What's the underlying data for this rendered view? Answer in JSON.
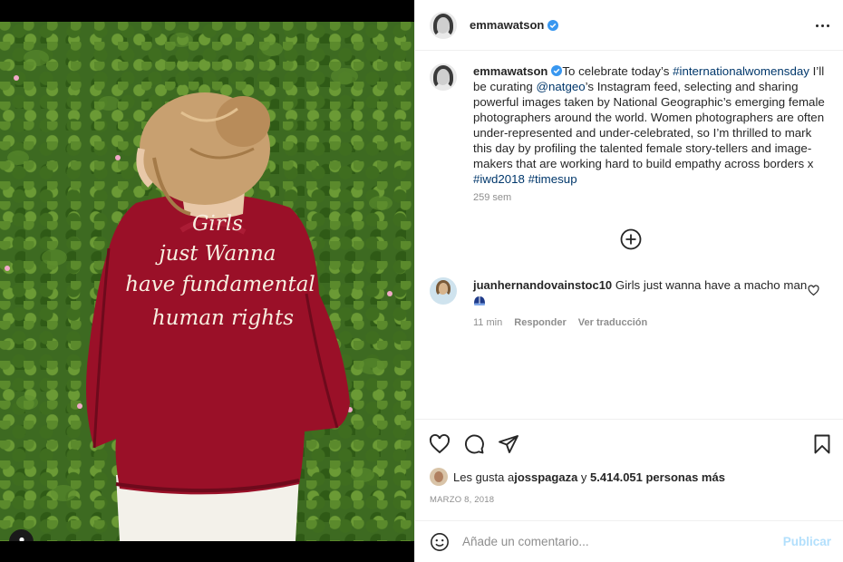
{
  "header": {
    "username": "emmawatson",
    "verified": true,
    "avatar_icon": "profile-avatar",
    "more_icon": "more-horizontal-icon"
  },
  "caption": {
    "username": "emmawatson",
    "text_1": "To celebrate today’s ",
    "hashtag_1": "#internationalwomensday",
    "text_2": " I’ll be curating ",
    "mention": "@natgeo",
    "text_3": "’s Instagram feed, selecting and sharing powerful images taken by National Geographic’s emerging female photographers around the world. Women photographers are often under-represented and under-celebrated, so I’m thrilled to mark this day by profiling the talented female story-tellers and image-makers that are working hard to build empathy across borders x ",
    "hashtag_2": "#iwd2018",
    "hashtag_3": "#timesup",
    "age": "259 sem"
  },
  "load_more_icon": "plus-circle-icon",
  "comment": {
    "username": "juanhernandovainstoc10",
    "text": "Girls just wanna have a macho man",
    "emoji": "helmet-emoji",
    "age": "11 min",
    "reply_label": "Responder",
    "translate_label": "Ver traducción"
  },
  "photo": {
    "jacket_lines": [
      "Girls",
      "just Wanna",
      "have fundamental",
      "human rights"
    ],
    "colors": {
      "jacket": "#9a1028",
      "hedge": "#3d6a21",
      "hair": "#c8a070"
    }
  },
  "likes": {
    "prefix": "Les gusta a ",
    "liker": "josspagaza",
    "middle": " y ",
    "count": "5.414.051 personas más"
  },
  "date": "MARZO 8, 2018",
  "composer": {
    "placeholder": "Añade un comentario...",
    "post_label": "Publicar"
  },
  "colors": {
    "link": "#00376b",
    "verified": "#3897f0",
    "post_disabled": "#b2dffc",
    "muted": "#8e8e8e"
  }
}
